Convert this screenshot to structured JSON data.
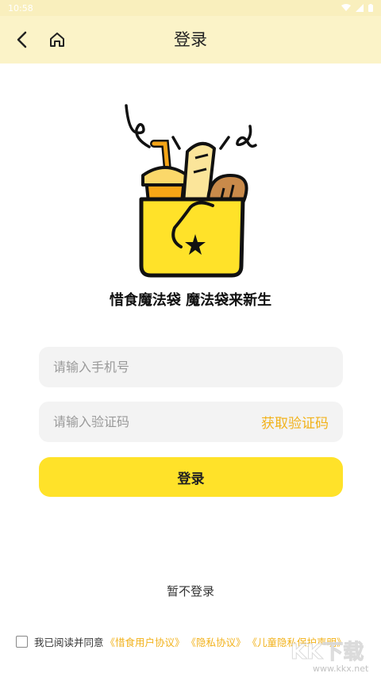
{
  "status_bar": {
    "time": "10:58"
  },
  "header": {
    "title": "登录"
  },
  "slogan": "惜食魔法袋  魔法袋来新生",
  "form": {
    "phone_placeholder": "请输入手机号",
    "code_placeholder": "请输入验证码",
    "get_code_label": "获取验证码",
    "login_label": "登录"
  },
  "skip_label": "暂不登录",
  "agreement": {
    "prefix": "我已阅读并同意",
    "links": [
      "《惜食用户协议》",
      "《隐私协议》",
      "《儿童隐私保护声明》"
    ]
  },
  "watermark": {
    "big": "KK下载",
    "small": "www.kkx.net"
  },
  "colors": {
    "accent": "#ffe229",
    "link": "#f2b21b",
    "header_bg": "#fbf3c8"
  }
}
